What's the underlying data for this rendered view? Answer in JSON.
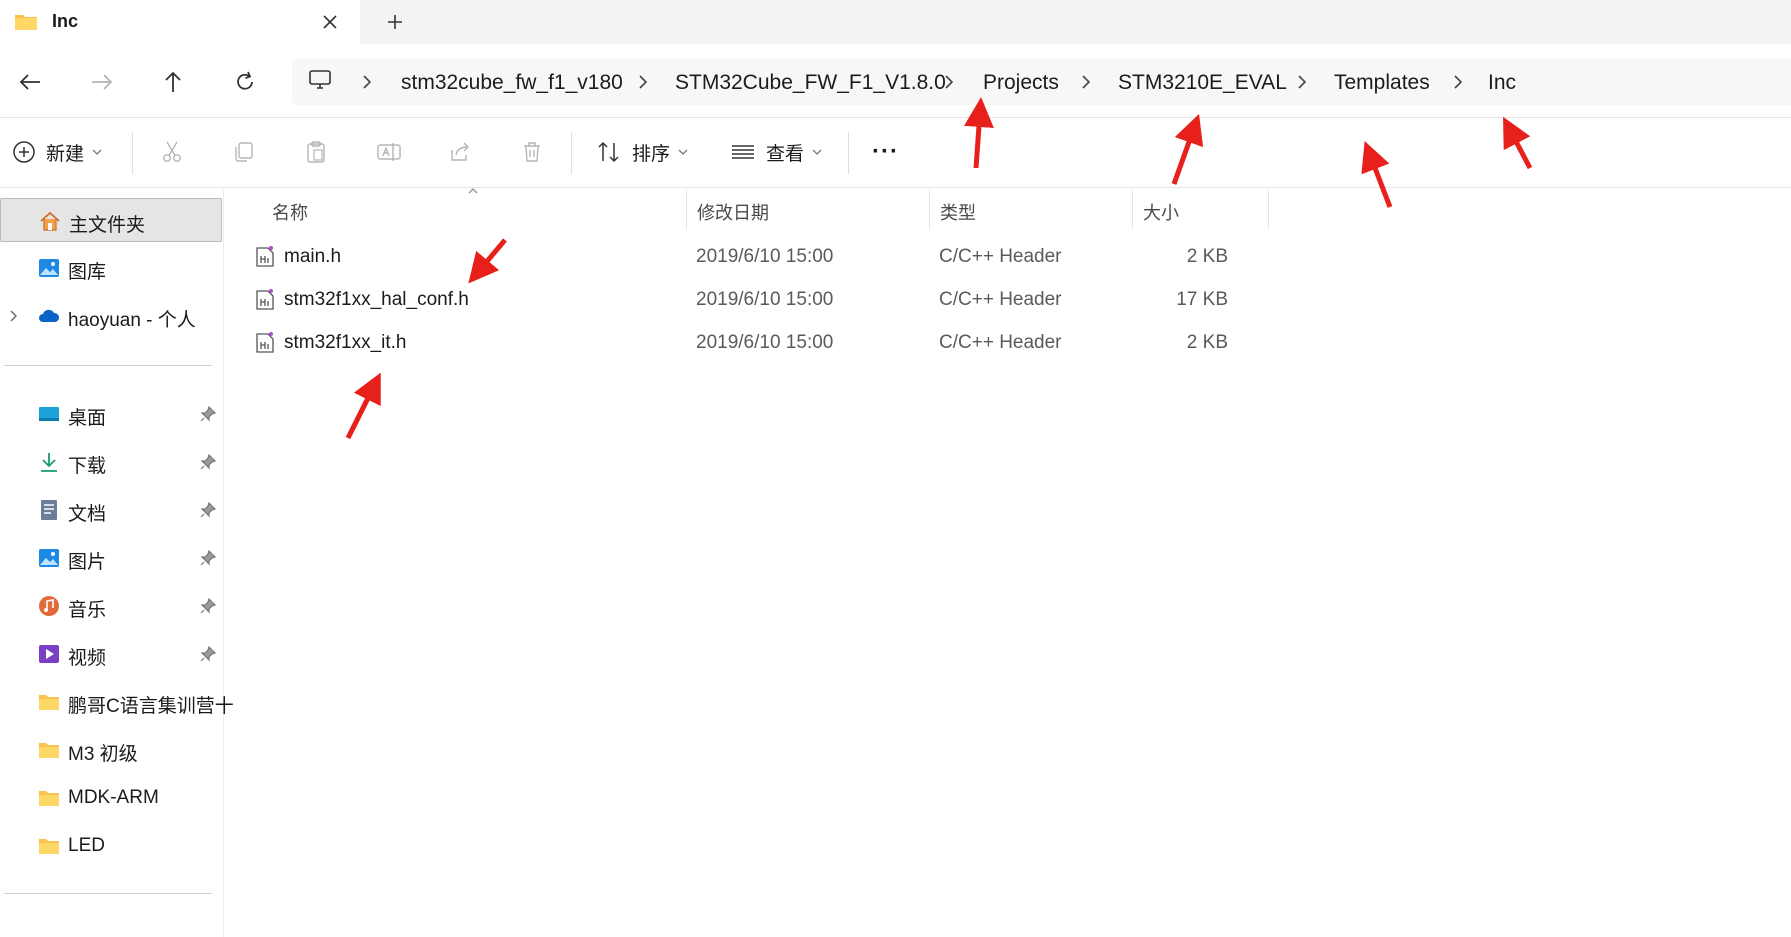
{
  "tab": {
    "title": "Inc",
    "new_tab_symbol": "+"
  },
  "breadcrumb": [
    "stm32cube_fw_f1_v180",
    "STM32Cube_FW_F1_V1.8.0",
    "Projects",
    "STM3210E_EVAL",
    "Templates",
    "Inc"
  ],
  "toolbar": {
    "new_label": "新建",
    "sort_label": "排序",
    "view_label": "查看",
    "more_label": "···"
  },
  "sidebar": {
    "home": "主文件夹",
    "gallery": "图库",
    "onedrive": "haoyuan - 个人",
    "quick": [
      {
        "label": "桌面",
        "icon": "desktop-icon"
      },
      {
        "label": "下载",
        "icon": "download-icon"
      },
      {
        "label": "文档",
        "icon": "document-icon"
      },
      {
        "label": "图片",
        "icon": "pictures-icon"
      },
      {
        "label": "音乐",
        "icon": "music-icon"
      },
      {
        "label": "视频",
        "icon": "video-icon"
      }
    ],
    "folders": [
      "鹏哥C语言集训营十",
      "M3 初级",
      "MDK-ARM",
      "LED"
    ]
  },
  "columns": {
    "name": "名称",
    "date": "修改日期",
    "type": "类型",
    "size": "大小"
  },
  "files": [
    {
      "name": "main.h",
      "date": "2019/6/10 15:00",
      "type": "C/C++ Header",
      "size": "2 KB"
    },
    {
      "name": "stm32f1xx_hal_conf.h",
      "date": "2019/6/10 15:00",
      "type": "C/C++ Header",
      "size": "17 KB"
    },
    {
      "name": "stm32f1xx_it.h",
      "date": "2019/6/10 15:00",
      "type": "C/C++ Header",
      "size": "2 KB"
    }
  ],
  "colors": {
    "annotation_arrow": "#e8201c",
    "folder": "#f8c24a",
    "accent": "#0067c0"
  }
}
